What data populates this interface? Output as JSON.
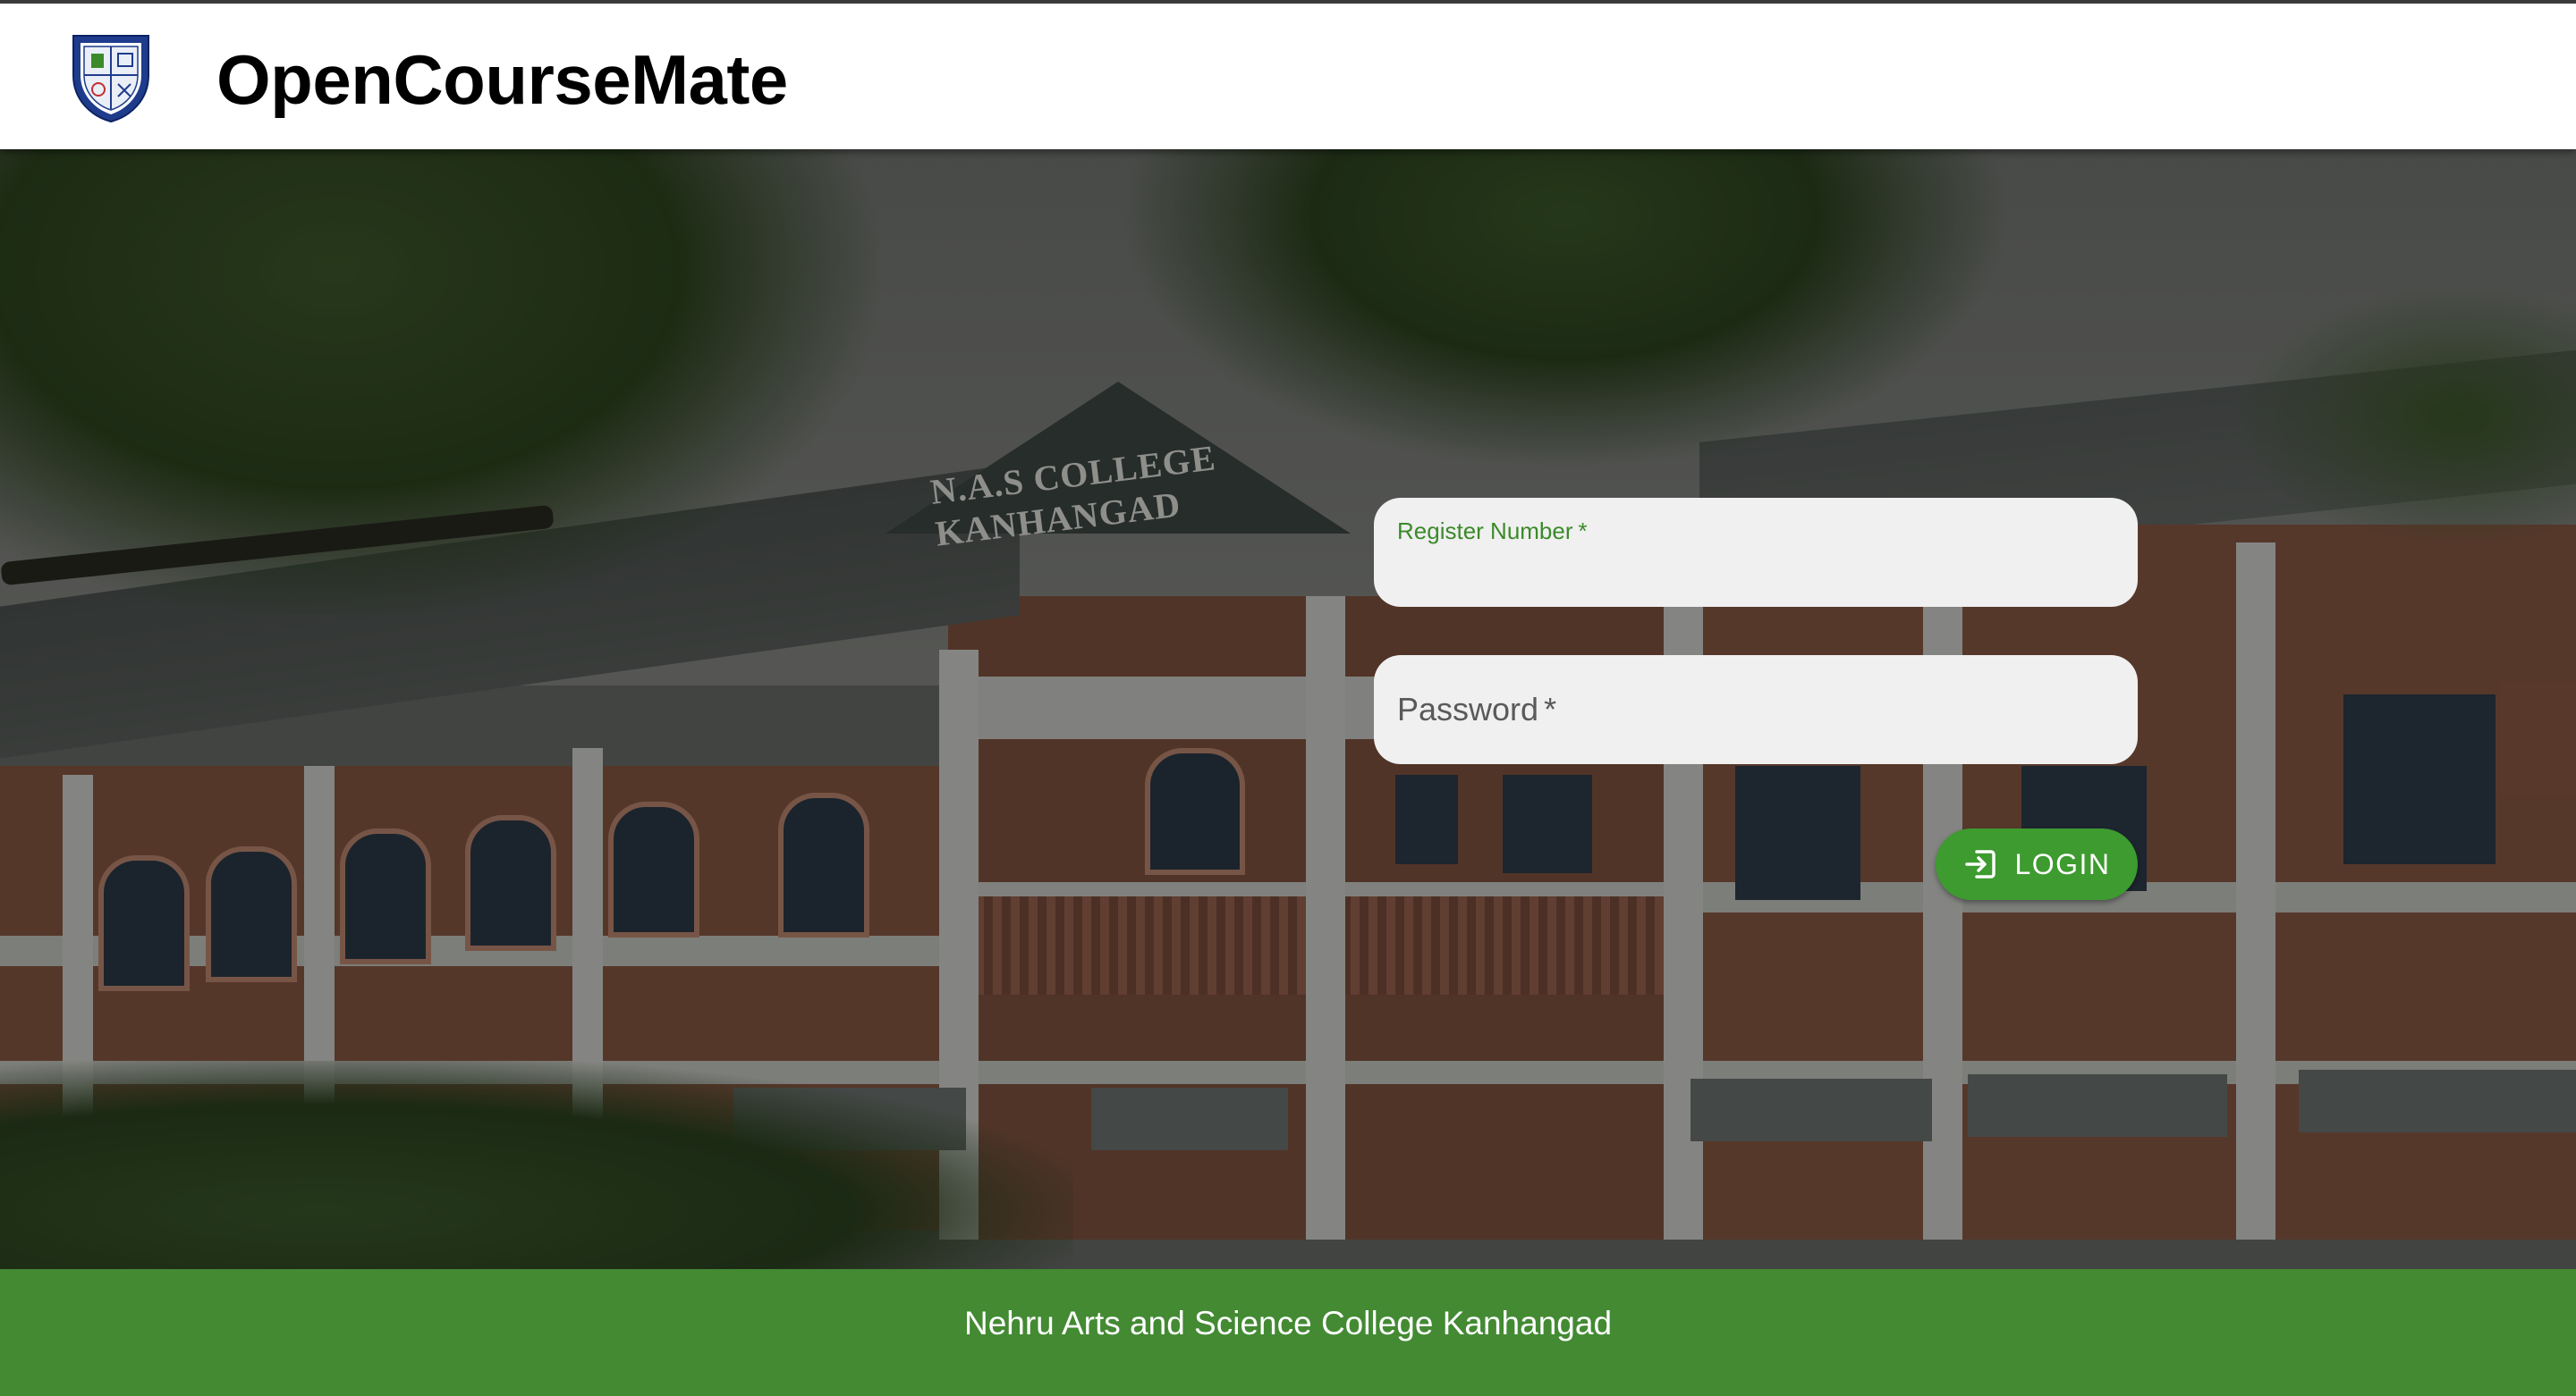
{
  "header": {
    "app_title": "OpenCourseMate",
    "logo_icon": "college-crest-icon"
  },
  "hero": {
    "background": "college-building-photo",
    "sign_text": "N.A.S COLLEGE KANHANGAD"
  },
  "login_form": {
    "register_number": {
      "label": "Register Number",
      "required_mark": "*",
      "value": ""
    },
    "password": {
      "label": "Password",
      "required_mark": "*",
      "value": ""
    },
    "login_button": {
      "label": "LOGIN",
      "icon": "login-icon"
    }
  },
  "footer": {
    "text": "Nehru Arts and Science College Kanhangad"
  },
  "colors": {
    "accent_green": "#3d9b2f",
    "footer_green": "#438a33",
    "field_bg": "#f0f0f0",
    "label_green": "#3b8a2a"
  }
}
